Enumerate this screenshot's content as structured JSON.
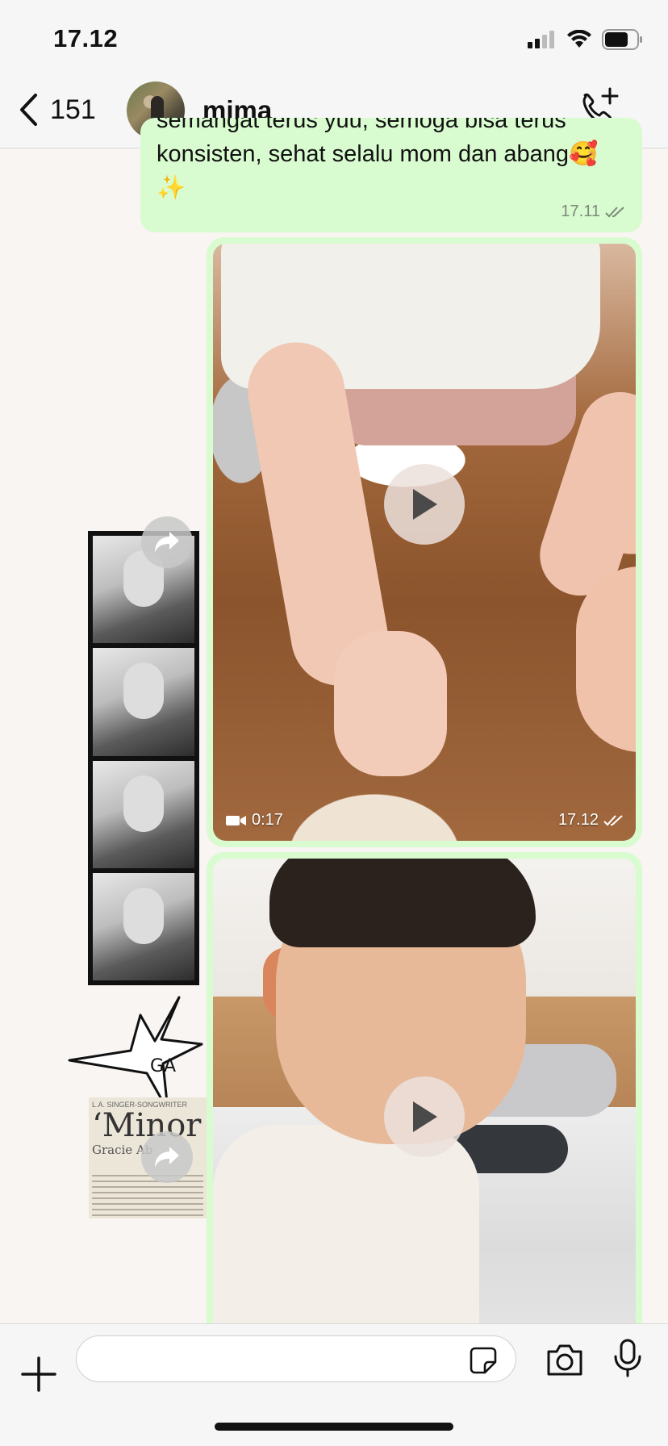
{
  "status_bar": {
    "time": "17.12"
  },
  "header": {
    "back_count": "151",
    "contact_name": "mima"
  },
  "messages": [
    {
      "text_partial": "semangat terus yuu, semoga bisa terus",
      "text": "konsisten, sehat selalu mom dan abang🥰",
      "text_end": "✨",
      "time": "17.11"
    },
    {
      "video_duration": "0:17",
      "time": "17.12"
    },
    {}
  ],
  "stickers": {
    "star_text": "GA",
    "newspaper_header": "L.A. SINGER-SONGWRITER",
    "newspaper_title": "‘Minor",
    "newspaper_sub": "Gracie Ab"
  },
  "input": {
    "placeholder": ""
  },
  "colors": {
    "bubble": "#d9fbd0",
    "header_bg": "#f6f6f6",
    "chat_bg": "#f8f5f2",
    "meta_text": "#7b8a78"
  },
  "icons": [
    "back-chevron-icon",
    "add-call-icon",
    "play-icon",
    "forward-icon",
    "video-camera-icon",
    "double-check-icon",
    "plus-icon",
    "sticker-icon",
    "camera-icon",
    "microphone-icon"
  ]
}
